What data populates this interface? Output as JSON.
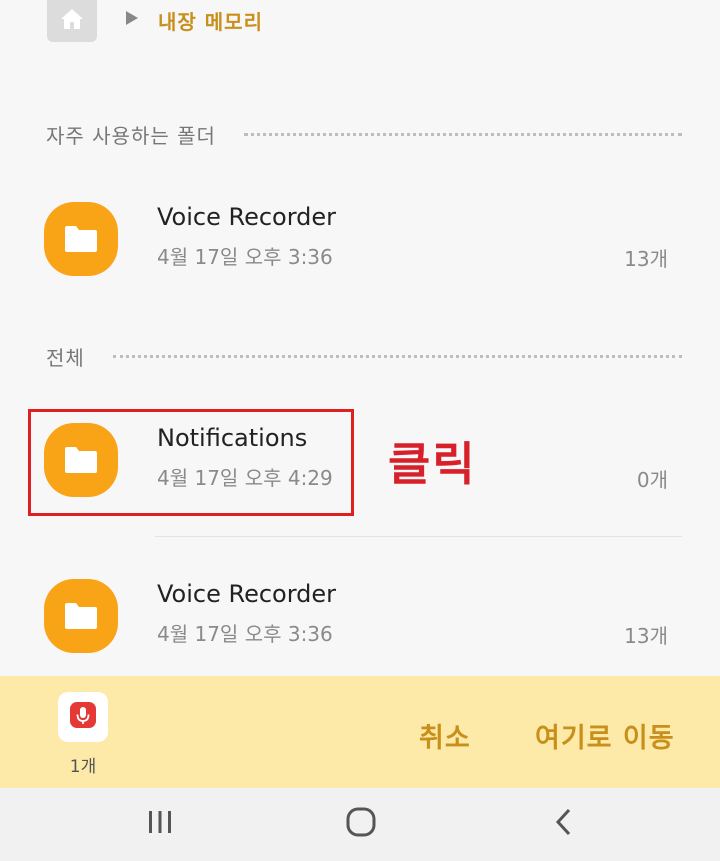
{
  "breadcrumb": {
    "location": "내장 메모리"
  },
  "sections": {
    "frequent": "자주 사용하는 폴더",
    "all": "전체"
  },
  "frequent_folders": [
    {
      "name": "Voice Recorder",
      "date": "4월 17일 오후 3:36",
      "count": "13개"
    }
  ],
  "all_folders": [
    {
      "name": "Notifications",
      "date": "4월 17일 오후 4:29",
      "count": "0개"
    },
    {
      "name": "Voice Recorder",
      "date": "4월 17일 오후 3:36",
      "count": "13개"
    }
  ],
  "annotation": {
    "text": "클릭",
    "color": "#d8202a"
  },
  "bottom_bar": {
    "selected_count": "1개",
    "cancel_label": "취소",
    "move_label": "여기로 이동"
  },
  "icons": {
    "home": "home-icon",
    "breadcrumb_arrow": "play-arrow-icon",
    "folder": "folder-icon",
    "selected_file": "microphone-icon",
    "nav_recents": "recents-icon",
    "nav_home": "home-circle-icon",
    "nav_back": "back-icon"
  },
  "colors": {
    "accent": "#c8901a",
    "folder": "#f9a317",
    "bottom_bar": "#fdeaa9"
  }
}
